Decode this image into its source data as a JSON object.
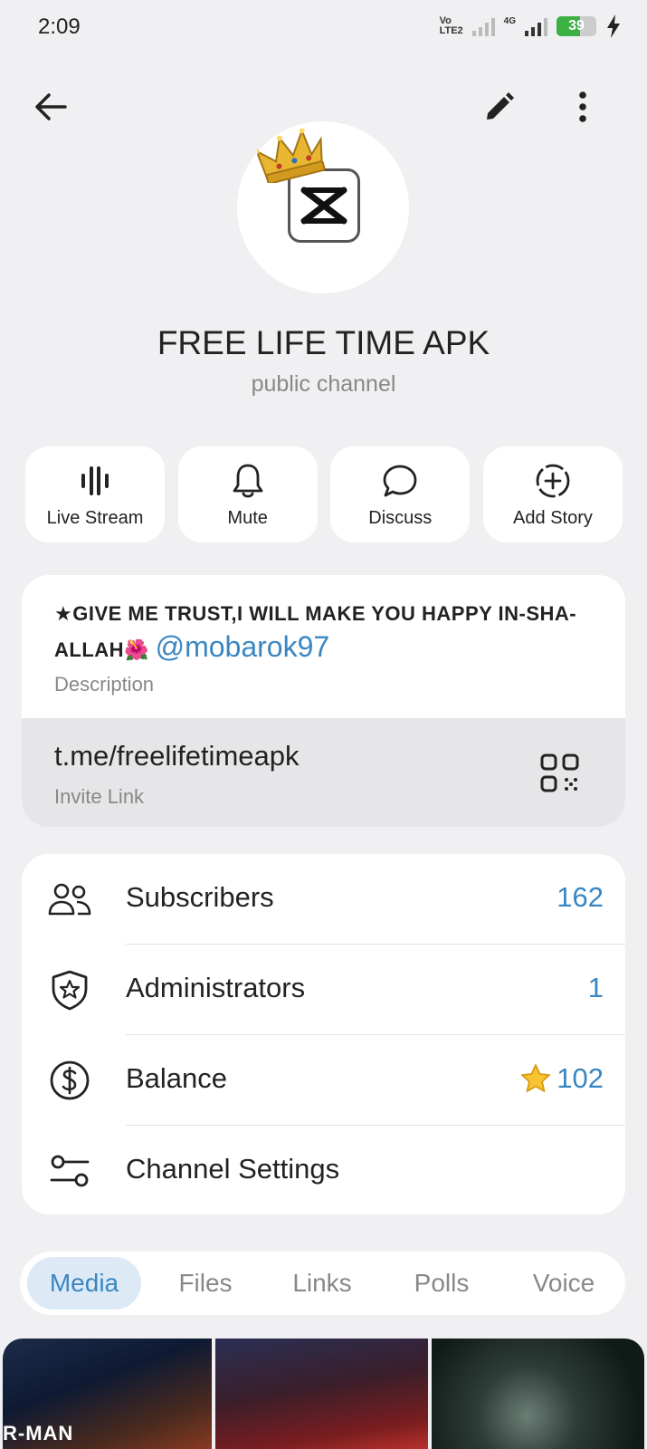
{
  "status_bar": {
    "time": "2:09",
    "volte_line1": "Vo",
    "volte_line2": "LTE2",
    "network": "4G",
    "battery": "39",
    "battery_level": 0.39
  },
  "toolbar": {
    "back_icon": "arrow-left-icon",
    "edit_icon": "pencil-icon",
    "more_icon": "more-vertical-icon"
  },
  "channel": {
    "name": "FREE LIFE TIME APK",
    "type": "public channel"
  },
  "actions": [
    {
      "label": "Live Stream",
      "icon": "live-stream-icon"
    },
    {
      "label": "Mute",
      "icon": "bell-icon"
    },
    {
      "label": "Discuss",
      "icon": "chat-bubble-icon"
    },
    {
      "label": "Add Story",
      "icon": "add-story-icon"
    }
  ],
  "info": {
    "description_prefix": "★",
    "description": "GIVE ME TRUST,I WILL MAKE YOU HAPPY IN-SHA-ALLAH",
    "description_emoji": "🌺",
    "mention": "@mobarok97",
    "description_label": "Description",
    "invite_link": "t.me/freelifetimeapk",
    "invite_label": "Invite Link"
  },
  "stats": {
    "subscribers_label": "Subscribers",
    "subscribers_value": "162",
    "administrators_label": "Administrators",
    "administrators_value": "1",
    "balance_label": "Balance",
    "balance_value": "102",
    "settings_label": "Channel Settings"
  },
  "tabs": [
    {
      "label": "Media",
      "active": true
    },
    {
      "label": "Files",
      "active": false
    },
    {
      "label": "Links",
      "active": false
    },
    {
      "label": "Polls",
      "active": false
    },
    {
      "label": "Voice",
      "active": false
    }
  ],
  "media": {
    "thumb1_text": "R-MAN"
  },
  "colors": {
    "accent": "#3a86c2",
    "background": "#f0f0f2",
    "active_tab_bg": "#ddeaf6",
    "battery_green": "#3cb043"
  }
}
